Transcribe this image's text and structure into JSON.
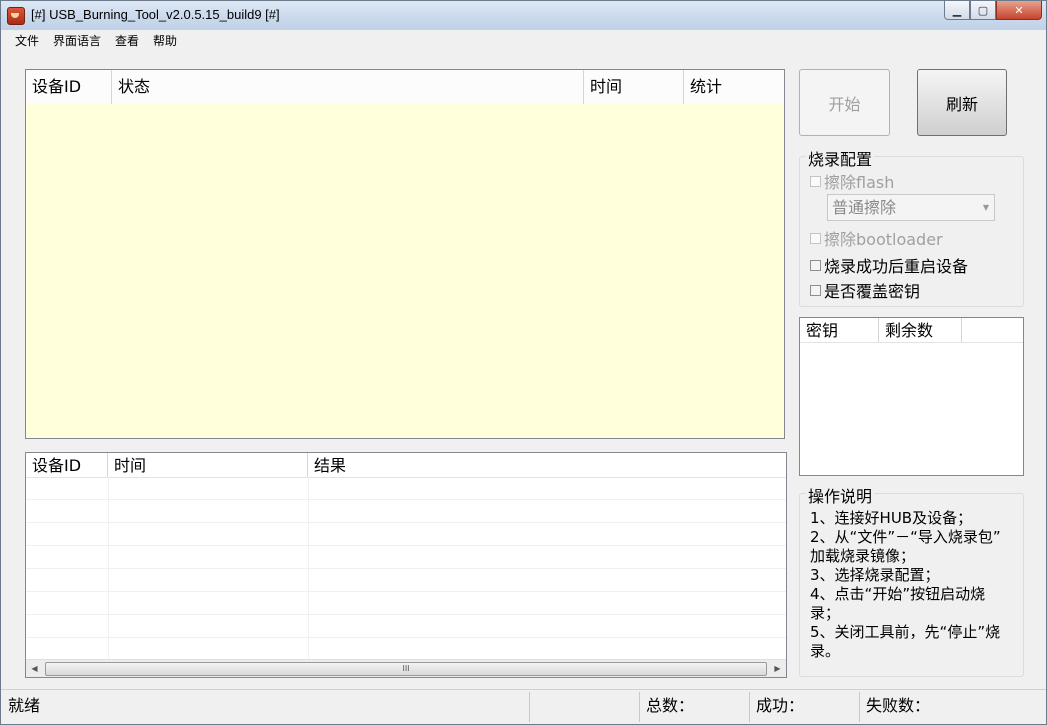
{
  "window": {
    "title": "[#] USB_Burning_Tool_v2.0.5.15_build9 [#]",
    "controls": [
      "minimize-icon",
      "maximize-icon",
      "close-icon"
    ]
  },
  "menu": [
    "文件",
    "界面语言",
    "查看",
    "帮助"
  ],
  "device_table": {
    "columns": [
      "设备ID",
      "状态",
      "时间",
      "统计"
    ],
    "rows": [],
    "body_color": "#ffffdc"
  },
  "log_table": {
    "columns": [
      "设备ID",
      "时间",
      "结果"
    ],
    "rows": [],
    "scroll_thumb_glyph": "III"
  },
  "buttons": {
    "start": "开始",
    "refresh": "刷新"
  },
  "burn_config": {
    "title": "烧录配置",
    "erase_flash": "擦除flash",
    "erase_mode": "普通擦除",
    "erase_bootloader": "擦除bootloader",
    "reboot_after": "烧录成功后重启设备",
    "overwrite_key": "是否覆盖密钥"
  },
  "key_table": {
    "columns": [
      "密钥",
      "剩余数"
    ],
    "rows": []
  },
  "instructions": {
    "title": "操作说明",
    "lines": [
      "1、连接好HUB及设备；",
      "2、从“文件”－“导入烧录包”",
      "加载烧录镜像；",
      "3、选择烧录配置；",
      "4、点击“开始”按钮启动烧",
      "录；",
      "5、关闭工具前，先“停止”烧",
      "录。"
    ]
  },
  "status_bar": {
    "status": "就绪",
    "total_label": "总数：",
    "success_label": "成功：",
    "fail_label": "失败数："
  }
}
